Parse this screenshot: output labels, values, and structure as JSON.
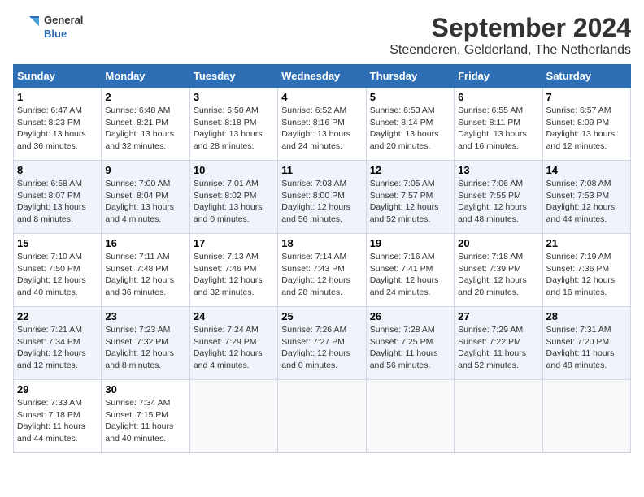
{
  "logo": {
    "line1": "General",
    "line2": "Blue"
  },
  "title": "September 2024",
  "subtitle": "Steenderen, Gelderland, The Netherlands",
  "headers": [
    "Sunday",
    "Monday",
    "Tuesday",
    "Wednesday",
    "Thursday",
    "Friday",
    "Saturday"
  ],
  "weeks": [
    [
      {
        "day": "1",
        "info": "Sunrise: 6:47 AM\nSunset: 8:23 PM\nDaylight: 13 hours\nand 36 minutes."
      },
      {
        "day": "2",
        "info": "Sunrise: 6:48 AM\nSunset: 8:21 PM\nDaylight: 13 hours\nand 32 minutes."
      },
      {
        "day": "3",
        "info": "Sunrise: 6:50 AM\nSunset: 8:18 PM\nDaylight: 13 hours\nand 28 minutes."
      },
      {
        "day": "4",
        "info": "Sunrise: 6:52 AM\nSunset: 8:16 PM\nDaylight: 13 hours\nand 24 minutes."
      },
      {
        "day": "5",
        "info": "Sunrise: 6:53 AM\nSunset: 8:14 PM\nDaylight: 13 hours\nand 20 minutes."
      },
      {
        "day": "6",
        "info": "Sunrise: 6:55 AM\nSunset: 8:11 PM\nDaylight: 13 hours\nand 16 minutes."
      },
      {
        "day": "7",
        "info": "Sunrise: 6:57 AM\nSunset: 8:09 PM\nDaylight: 13 hours\nand 12 minutes."
      }
    ],
    [
      {
        "day": "8",
        "info": "Sunrise: 6:58 AM\nSunset: 8:07 PM\nDaylight: 13 hours\nand 8 minutes."
      },
      {
        "day": "9",
        "info": "Sunrise: 7:00 AM\nSunset: 8:04 PM\nDaylight: 13 hours\nand 4 minutes."
      },
      {
        "day": "10",
        "info": "Sunrise: 7:01 AM\nSunset: 8:02 PM\nDaylight: 13 hours\nand 0 minutes."
      },
      {
        "day": "11",
        "info": "Sunrise: 7:03 AM\nSunset: 8:00 PM\nDaylight: 12 hours\nand 56 minutes."
      },
      {
        "day": "12",
        "info": "Sunrise: 7:05 AM\nSunset: 7:57 PM\nDaylight: 12 hours\nand 52 minutes."
      },
      {
        "day": "13",
        "info": "Sunrise: 7:06 AM\nSunset: 7:55 PM\nDaylight: 12 hours\nand 48 minutes."
      },
      {
        "day": "14",
        "info": "Sunrise: 7:08 AM\nSunset: 7:53 PM\nDaylight: 12 hours\nand 44 minutes."
      }
    ],
    [
      {
        "day": "15",
        "info": "Sunrise: 7:10 AM\nSunset: 7:50 PM\nDaylight: 12 hours\nand 40 minutes."
      },
      {
        "day": "16",
        "info": "Sunrise: 7:11 AM\nSunset: 7:48 PM\nDaylight: 12 hours\nand 36 minutes."
      },
      {
        "day": "17",
        "info": "Sunrise: 7:13 AM\nSunset: 7:46 PM\nDaylight: 12 hours\nand 32 minutes."
      },
      {
        "day": "18",
        "info": "Sunrise: 7:14 AM\nSunset: 7:43 PM\nDaylight: 12 hours\nand 28 minutes."
      },
      {
        "day": "19",
        "info": "Sunrise: 7:16 AM\nSunset: 7:41 PM\nDaylight: 12 hours\nand 24 minutes."
      },
      {
        "day": "20",
        "info": "Sunrise: 7:18 AM\nSunset: 7:39 PM\nDaylight: 12 hours\nand 20 minutes."
      },
      {
        "day": "21",
        "info": "Sunrise: 7:19 AM\nSunset: 7:36 PM\nDaylight: 12 hours\nand 16 minutes."
      }
    ],
    [
      {
        "day": "22",
        "info": "Sunrise: 7:21 AM\nSunset: 7:34 PM\nDaylight: 12 hours\nand 12 minutes."
      },
      {
        "day": "23",
        "info": "Sunrise: 7:23 AM\nSunset: 7:32 PM\nDaylight: 12 hours\nand 8 minutes."
      },
      {
        "day": "24",
        "info": "Sunrise: 7:24 AM\nSunset: 7:29 PM\nDaylight: 12 hours\nand 4 minutes."
      },
      {
        "day": "25",
        "info": "Sunrise: 7:26 AM\nSunset: 7:27 PM\nDaylight: 12 hours\nand 0 minutes."
      },
      {
        "day": "26",
        "info": "Sunrise: 7:28 AM\nSunset: 7:25 PM\nDaylight: 11 hours\nand 56 minutes."
      },
      {
        "day": "27",
        "info": "Sunrise: 7:29 AM\nSunset: 7:22 PM\nDaylight: 11 hours\nand 52 minutes."
      },
      {
        "day": "28",
        "info": "Sunrise: 7:31 AM\nSunset: 7:20 PM\nDaylight: 11 hours\nand 48 minutes."
      }
    ],
    [
      {
        "day": "29",
        "info": "Sunrise: 7:33 AM\nSunset: 7:18 PM\nDaylight: 11 hours\nand 44 minutes."
      },
      {
        "day": "30",
        "info": "Sunrise: 7:34 AM\nSunset: 7:15 PM\nDaylight: 11 hours\nand 40 minutes."
      },
      {
        "day": "",
        "info": ""
      },
      {
        "day": "",
        "info": ""
      },
      {
        "day": "",
        "info": ""
      },
      {
        "day": "",
        "info": ""
      },
      {
        "day": "",
        "info": ""
      }
    ]
  ]
}
